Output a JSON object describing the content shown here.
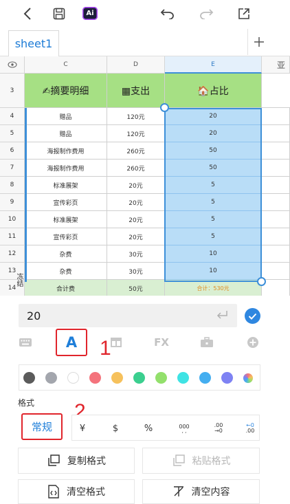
{
  "toolbar": {
    "back_icon": "chevron-left-icon",
    "save_icon": "save-icon",
    "ai_label": "Ai",
    "undo_icon": "undo-icon",
    "redo_icon": "redo-icon",
    "share_icon": "share-icon"
  },
  "sheet_tabs": {
    "tab": "sheet1",
    "add_label": "+"
  },
  "grid": {
    "columns": [
      "C",
      "D",
      "E"
    ],
    "edge_glyph": "亚",
    "header_row": {
      "row": "3",
      "c": "✍摘要明细",
      "d": "▦支出",
      "e": "🏠占比"
    },
    "rows": [
      {
        "row": "4",
        "c": "赠品",
        "d": "120元",
        "e": "20"
      },
      {
        "row": "5",
        "c": "赠品",
        "d": "120元",
        "e": "20"
      },
      {
        "row": "6",
        "c": "海报制作费用",
        "d": "260元",
        "e": "50"
      },
      {
        "row": "7",
        "c": "海报制作费用",
        "d": "260元",
        "e": "50"
      },
      {
        "row": "8",
        "c": "标准展架",
        "d": "20元",
        "e": "5"
      },
      {
        "row": "9",
        "c": "宣传彩页",
        "d": "20元",
        "e": "5"
      },
      {
        "row": "10",
        "c": "标准展架",
        "d": "20元",
        "e": "5"
      },
      {
        "row": "11",
        "c": "宣传彩页",
        "d": "20元",
        "e": "5"
      },
      {
        "row": "12",
        "c": "杂费",
        "d": "30元",
        "e": "10"
      },
      {
        "row": "13",
        "c": "杂费",
        "d": "30元",
        "e": "10"
      }
    ],
    "total_row": {
      "row": "14",
      "c": "合计费",
      "d": "50元",
      "e": "合计：530元"
    },
    "side_glyph": "冻结"
  },
  "formula": {
    "value": "20"
  },
  "function_tabs": {
    "keyboard_icon": "keyboard-icon",
    "font_label": "A",
    "cell_icon": "cell-format-icon",
    "fx_label": "FX",
    "tools_icon": "toolbox-icon",
    "insert_icon": "plus-circle-icon"
  },
  "annotations": {
    "one": "1",
    "two": "2"
  },
  "colors": [
    "#5b5b5b",
    "#a3a6ad",
    "#ffffff",
    "#f4737c",
    "#f6c15c",
    "#3bcf8f",
    "#93e06c",
    "#3fe3e4",
    "#44aef0",
    "#7e82f3",
    "#888888"
  ],
  "format": {
    "label": "格式",
    "normal": "常规",
    "yen": "¥",
    "dollar": "$",
    "percent": "%",
    "thousands": "000",
    "dec_add_top": ".00",
    "dec_add_bot": "→0",
    "dec_del_top": "←0",
    "dec_del_bot": ".00"
  },
  "actions": {
    "copy_format": "复制格式",
    "paste_format": "粘贴格式",
    "clear_format": "清空格式",
    "clear_content": "清空内容"
  }
}
